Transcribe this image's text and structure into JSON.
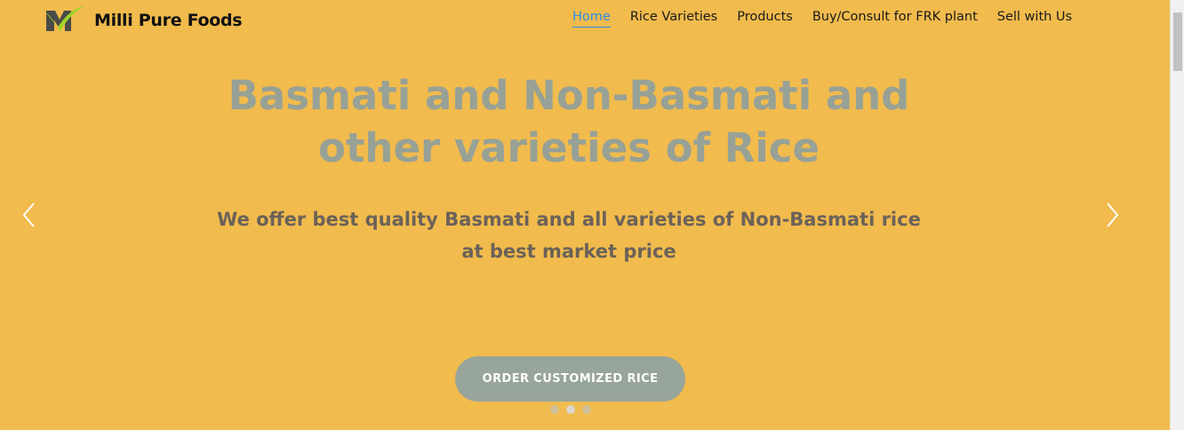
{
  "brand": {
    "name": "Milli Pure Foods",
    "logo_colors": {
      "m_dark": "#4a4a48",
      "check": "#9fd426"
    }
  },
  "nav": {
    "items": [
      {
        "label": "Home",
        "active": true
      },
      {
        "label": "Rice Varieties",
        "active": false
      },
      {
        "label": "Products",
        "active": false
      },
      {
        "label": "Buy/Consult for FRK plant",
        "active": false
      },
      {
        "label": "Sell with Us",
        "active": false
      }
    ],
    "active_color": "#2e8de6"
  },
  "hero": {
    "headline_line1": "Basmati and Non-Basmati and",
    "headline_line2": "other varieties of Rice",
    "subtext_line1": "We offer best quality Basmati and all varieties of Non-Basmati rice",
    "subtext_line2": "at best market price",
    "cta_label": "ORDER CUSTOMIZED RICE",
    "background_color": "#f1bb4d",
    "prev_icon": "chevron-left-icon",
    "next_icon": "chevron-right-icon",
    "slides_total": 3,
    "slide_active": 2
  }
}
